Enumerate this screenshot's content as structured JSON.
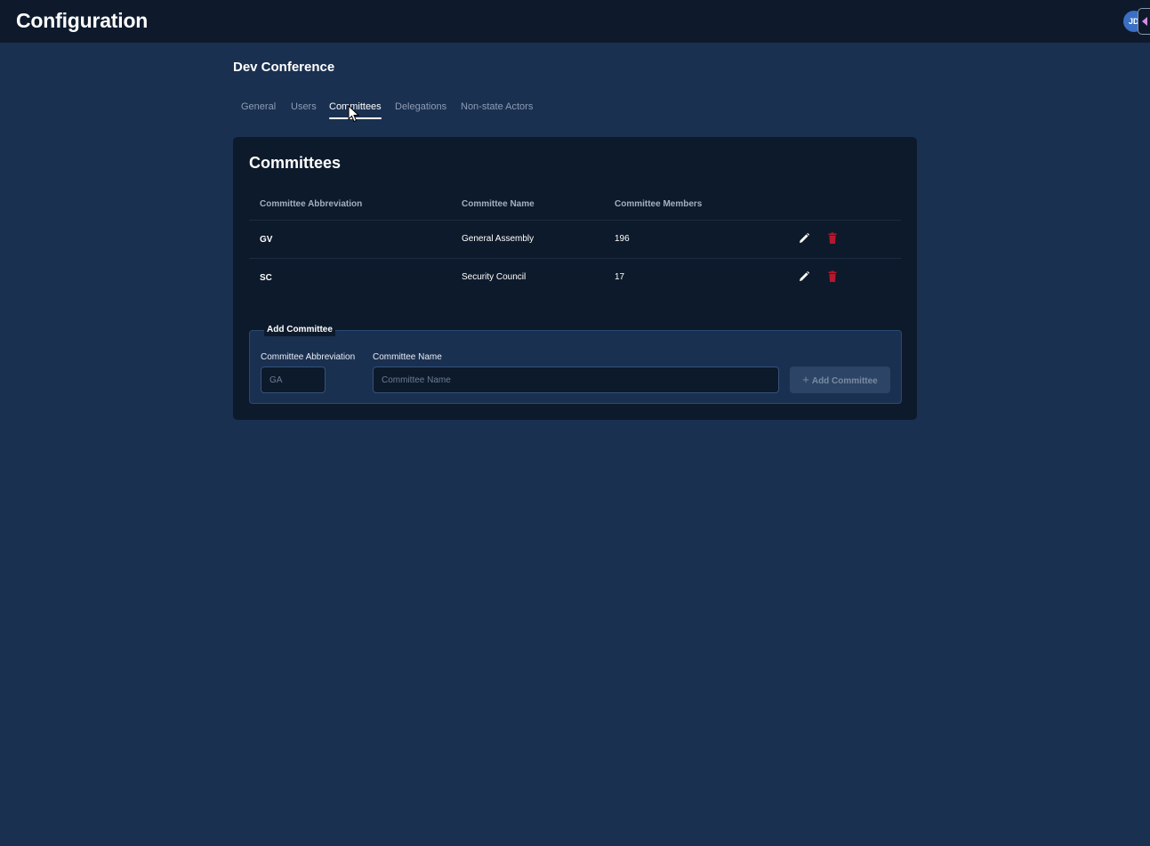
{
  "header": {
    "title": "Configuration",
    "avatar_initials": "JD"
  },
  "conference": {
    "title": "Dev Conference"
  },
  "tabs": [
    {
      "label": "General",
      "active": false
    },
    {
      "label": "Users",
      "active": false
    },
    {
      "label": "Committees",
      "active": true
    },
    {
      "label": "Delegations",
      "active": false
    },
    {
      "label": "Non-state Actors",
      "active": false
    }
  ],
  "committees": {
    "title": "Committees",
    "columns": [
      "Committee Abbreviation",
      "Committee Name",
      "Committee Members"
    ],
    "rows": [
      {
        "abbreviation": "GV",
        "name": "General Assembly",
        "members": "196"
      },
      {
        "abbreviation": "SC",
        "name": "Security Council",
        "members": "17"
      }
    ]
  },
  "add_committee": {
    "legend": "Add Committee",
    "abbreviation_label": "Committee Abbreviation",
    "abbreviation_placeholder": "GA",
    "abbreviation_value": "",
    "name_label": "Committee Name",
    "name_placeholder": "Committee Name",
    "name_value": "",
    "button_label": "Add Committee",
    "button_icon": "plus-icon"
  },
  "colors": {
    "background": "#1a3050",
    "topbar": "#0e1a2c",
    "card": "#0d1a2b",
    "delete_icon": "#b3182e",
    "edit_icon": "#ffffff"
  }
}
